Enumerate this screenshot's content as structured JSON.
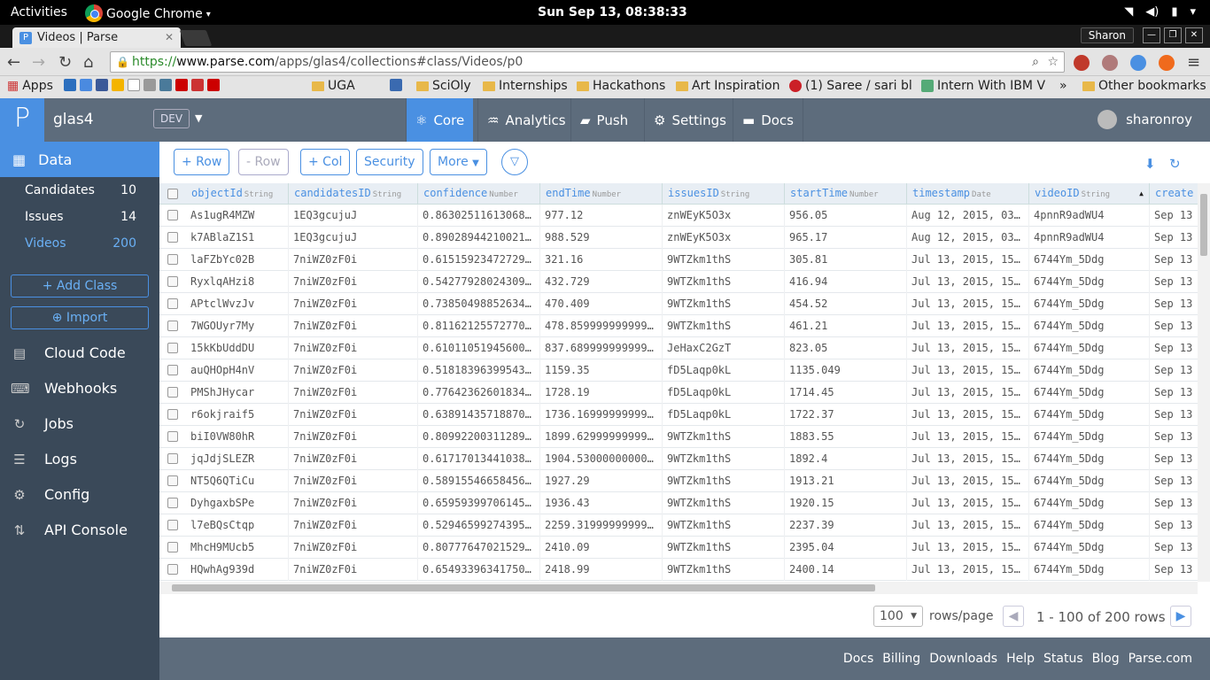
{
  "os": {
    "activities": "Activities",
    "app_name": "Google Chrome",
    "app_caret": "▾",
    "clock": "Sun Sep 13, 08:38:33"
  },
  "browser": {
    "tab_title": "Videos | Parse",
    "tab_favicon": "P",
    "profile": "Sharon",
    "url_scheme": "https://",
    "url_host": "www.parse.com",
    "url_path": "/apps/glas4/collections#class/Videos/p0"
  },
  "bookmarks": {
    "apps": "Apps",
    "uga": "UGA",
    "scioly": "SciOly",
    "internships": "Internships",
    "hackathons": "Hackathons",
    "art": "Art Inspiration",
    "saree": "(1) Saree / sari bl",
    "ibm": "Intern With IBM V",
    "more": "»",
    "other": "Other bookmarks"
  },
  "header": {
    "logo": "P",
    "app_name": "glas4",
    "env": "DEV",
    "nav": [
      {
        "label": "Core"
      },
      {
        "label": "Analytics"
      },
      {
        "label": "Push"
      },
      {
        "label": "Settings"
      },
      {
        "label": "Docs"
      }
    ],
    "user": "sharonroy"
  },
  "sidebar": {
    "data_label": "Data",
    "classes": [
      {
        "name": "Candidates",
        "count": "10"
      },
      {
        "name": "Issues",
        "count": "14"
      },
      {
        "name": "Videos",
        "count": "200"
      }
    ],
    "add_class": "Add Class",
    "import": "Import",
    "items": [
      {
        "label": "Cloud Code"
      },
      {
        "label": "Webhooks"
      },
      {
        "label": "Jobs"
      },
      {
        "label": "Logs"
      },
      {
        "label": "Config"
      },
      {
        "label": "API Console"
      }
    ]
  },
  "toolbar": {
    "add_row": "+ Row",
    "remove_row": "- Row",
    "add_col": "+ Col",
    "security": "Security",
    "more": "More"
  },
  "table": {
    "columns": [
      {
        "name": "objectId",
        "type": "String"
      },
      {
        "name": "candidatesID",
        "type": "String"
      },
      {
        "name": "confidence",
        "type": "Number"
      },
      {
        "name": "endTime",
        "type": "Number"
      },
      {
        "name": "issuesID",
        "type": "String"
      },
      {
        "name": "startTime",
        "type": "Number"
      },
      {
        "name": "timestamp",
        "type": "Date"
      },
      {
        "name": "videoID",
        "type": "String"
      },
      {
        "name": "create",
        "type": ""
      }
    ],
    "sort_indicator": "▲",
    "rows": [
      [
        "As1ugR4MZW",
        "1EQ3gcujuJ",
        "0.86302511613068…",
        "977.12",
        "znWEyK5O3x",
        "956.05",
        "Aug 12, 2015, 03…",
        "4pnnR9adWU4",
        "Sep 13"
      ],
      [
        "k7ABlaZ1S1",
        "1EQ3gcujuJ",
        "0.89028944210021…",
        "988.529",
        "znWEyK5O3x",
        "965.17",
        "Aug 12, 2015, 03…",
        "4pnnR9adWU4",
        "Sep 13"
      ],
      [
        "laFZbYc02B",
        "7niWZ0zF0i",
        "0.61515923472729…",
        "321.16",
        "9WTZkm1thS",
        "305.81",
        "Jul 13, 2015, 15…",
        "6744Ym_5Ddg",
        "Sep 13"
      ],
      [
        "RyxlqAHzi8",
        "7niWZ0zF0i",
        "0.54277928024309…",
        "432.729",
        "9WTZkm1thS",
        "416.94",
        "Jul 13, 2015, 15…",
        "6744Ym_5Ddg",
        "Sep 13"
      ],
      [
        "APtclWvzJv",
        "7niWZ0zF0i",
        "0.73850498852634…",
        "470.409",
        "9WTZkm1thS",
        "454.52",
        "Jul 13, 2015, 15…",
        "6744Ym_5Ddg",
        "Sep 13"
      ],
      [
        "7WGOUyr7My",
        "7niWZ0zF0i",
        "0.81162125572770…",
        "478.859999999999…",
        "9WTZkm1thS",
        "461.21",
        "Jul 13, 2015, 15…",
        "6744Ym_5Ddg",
        "Sep 13"
      ],
      [
        "15kKbUddDU",
        "7niWZ0zF0i",
        "0.61011051945600…",
        "837.689999999999…",
        "JeHaxC2GzT",
        "823.05",
        "Jul 13, 2015, 15…",
        "6744Ym_5Ddg",
        "Sep 13"
      ],
      [
        "auQHOpH4nV",
        "7niWZ0zF0i",
        "0.51818396399543…",
        "1159.35",
        "fD5Laqp0kL",
        "1135.049",
        "Jul 13, 2015, 15…",
        "6744Ym_5Ddg",
        "Sep 13"
      ],
      [
        "PMShJHycar",
        "7niWZ0zF0i",
        "0.77642362601834…",
        "1728.19",
        "fD5Laqp0kL",
        "1714.45",
        "Jul 13, 2015, 15…",
        "6744Ym_5Ddg",
        "Sep 13"
      ],
      [
        "r6okjraif5",
        "7niWZ0zF0i",
        "0.63891435718870…",
        "1736.16999999999…",
        "fD5Laqp0kL",
        "1722.37",
        "Jul 13, 2015, 15…",
        "6744Ym_5Ddg",
        "Sep 13"
      ],
      [
        "biI0VW80hR",
        "7niWZ0zF0i",
        "0.80992200311289…",
        "1899.62999999999…",
        "9WTZkm1thS",
        "1883.55",
        "Jul 13, 2015, 15…",
        "6744Ym_5Ddg",
        "Sep 13"
      ],
      [
        "jqJdjSLEZR",
        "7niWZ0zF0i",
        "0.61717013441038…",
        "1904.53000000000…",
        "9WTZkm1thS",
        "1892.4",
        "Jul 13, 2015, 15…",
        "6744Ym_5Ddg",
        "Sep 13"
      ],
      [
        "NT5Q6QTiCu",
        "7niWZ0zF0i",
        "0.58915546658456…",
        "1927.29",
        "9WTZkm1thS",
        "1913.21",
        "Jul 13, 2015, 15…",
        "6744Ym_5Ddg",
        "Sep 13"
      ],
      [
        "DyhgaxbSPe",
        "7niWZ0zF0i",
        "0.65959399706145…",
        "1936.43",
        "9WTZkm1thS",
        "1920.15",
        "Jul 13, 2015, 15…",
        "6744Ym_5Ddg",
        "Sep 13"
      ],
      [
        "l7eBQsCtqp",
        "7niWZ0zF0i",
        "0.52946599274395…",
        "2259.31999999999…",
        "9WTZkm1thS",
        "2237.39",
        "Jul 13, 2015, 15…",
        "6744Ym_5Ddg",
        "Sep 13"
      ],
      [
        "MhcH9MUcb5",
        "7niWZ0zF0i",
        "0.80777647021529…",
        "2410.09",
        "9WTZkm1thS",
        "2395.04",
        "Jul 13, 2015, 15…",
        "6744Ym_5Ddg",
        "Sep 13"
      ],
      [
        "HQwhAg939d",
        "7niWZ0zF0i",
        "0.65493396341750…",
        "2418.99",
        "9WTZkm1thS",
        "2400.14",
        "Jul 13, 2015, 15…",
        "6744Ym_5Ddg",
        "Sep 13"
      ]
    ]
  },
  "pagination": {
    "page_size": "100",
    "rows_per_page": "rows/page",
    "range": "1 - 100 of 200 rows",
    "prev": "◀",
    "next": "▶"
  },
  "footer": {
    "links": [
      "Docs",
      "Billing",
      "Downloads",
      "Help",
      "Status",
      "Blog",
      "Parse.com"
    ]
  },
  "colors": {
    "accent": "#4a90e2",
    "header": "#5d6c7c",
    "sidebar": "#3a4959"
  }
}
